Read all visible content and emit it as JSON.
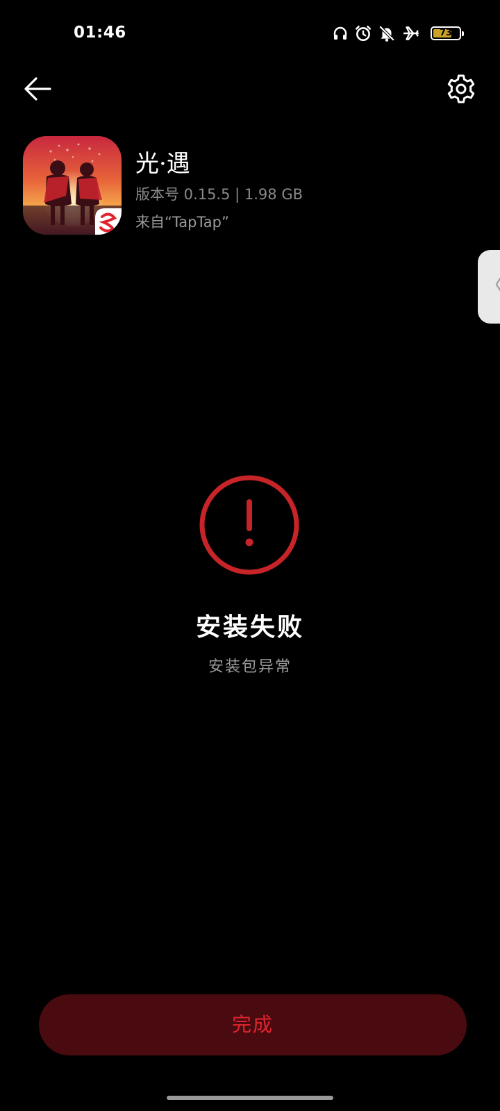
{
  "status_bar": {
    "time": "01:46",
    "battery_level": "73",
    "battery_fraction": 0.73,
    "icons": [
      "headphones-icon",
      "alarm-icon",
      "bell-off-icon",
      "airplane-icon",
      "battery-icon"
    ]
  },
  "nav": {
    "back_icon": "arrow-left-icon",
    "settings_icon": "gear-icon"
  },
  "app": {
    "name": "光·遇",
    "version_line": "版本号 0.15.5 | 1.98 GB",
    "source_line": "来自“TapTap”"
  },
  "side_handle": {
    "glyph": "〈"
  },
  "result": {
    "title": "安装失败",
    "subtitle": "安装包异常",
    "icon": "alert-circle-icon"
  },
  "actions": {
    "done_label": "完成"
  },
  "colors": {
    "background": "#000000",
    "accent_red": "#c62428",
    "button_bg": "#4a0b10",
    "button_text": "#e0242f",
    "secondary_text": "#9a9a9a",
    "battery_fill": "#c9a227"
  }
}
